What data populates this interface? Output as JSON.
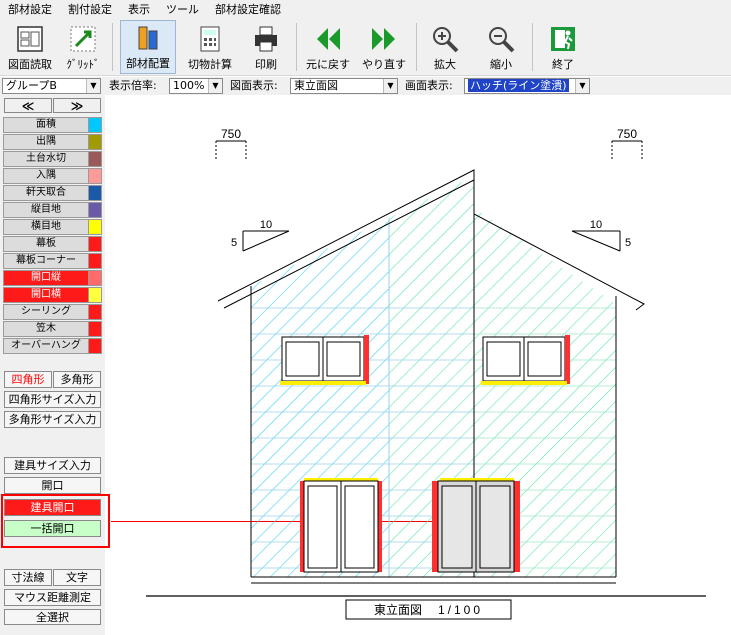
{
  "menu": [
    "部材設定",
    "割付設定",
    "表示",
    "ツール",
    "部材設定確認"
  ],
  "toolbar": {
    "load": "図面読取",
    "grid": "ｸﾞﾘｯﾄﾞ",
    "place": "部材配置",
    "calc": "切物計算",
    "print": "印刷",
    "undo": "元に戻す",
    "redo": "やり直す",
    "zoom_in": "拡大",
    "zoom_out": "縮小",
    "exit": "終了"
  },
  "options": {
    "group": "グループB",
    "scale_label": "表示倍率:",
    "scale": "100%",
    "view_label": "図面表示:",
    "view": "東立面図",
    "screen_label": "画面表示:",
    "screen": "ハッチ(ライン塗潰)"
  },
  "panel": {
    "prev": "≪",
    "next": "≫",
    "layers": [
      {
        "label": "面積",
        "color": "#00c8ff",
        "red": false
      },
      {
        "label": "出隅",
        "color": "#a09b00",
        "red": false
      },
      {
        "label": "土台水切",
        "color": "#9a5a5a",
        "red": false
      },
      {
        "label": "入隅",
        "color": "#ff9a9a",
        "red": false
      },
      {
        "label": "軒天取合",
        "color": "#1a5aa8",
        "red": false
      },
      {
        "label": "縦目地",
        "color": "#6a5aa8",
        "red": false
      },
      {
        "label": "横目地",
        "color": "#ffff00",
        "red": false
      },
      {
        "label": "幕板",
        "color": "#ff1a1a",
        "red": false
      },
      {
        "label": "幕板コーナー",
        "color": "#ff1a1a",
        "red": false
      },
      {
        "label": "開口縦",
        "color": "#ff6a6a",
        "red": true
      },
      {
        "label": "開口横",
        "color": "#ffff40",
        "red": true
      },
      {
        "label": "シーリング",
        "color": "#ff1a1a",
        "red": false
      },
      {
        "label": "笠木",
        "color": "#ff1a1a",
        "red": false
      },
      {
        "label": "オーバーハング",
        "color": "#ff1a1a",
        "red": false
      }
    ],
    "rect": "四角形",
    "poly": "多角形",
    "rect_size": "四角形サイズ入力",
    "poly_size": "多角形サイズ入力",
    "fitting_size": "建具サイズ入力",
    "opening": "開口",
    "fitting_opening": "建具開口",
    "bulk_opening": "一括開口",
    "dim_line": "寸法線",
    "text": "文字",
    "measure": "マウス距離測定",
    "select_all": "全選択"
  },
  "drawing": {
    "dim_left": "750",
    "dim_right": "750",
    "pitch_left_run": "10",
    "pitch_left_rise": "5",
    "pitch_right_run": "10",
    "pitch_right_rise": "5",
    "title": "東立面図",
    "scale": "1/100"
  },
  "colors": {
    "hatch_cyan": "#3fd0f0",
    "hatch_green": "#5ee8a8",
    "frame_red": "#ff3030",
    "frame_yellow": "#ffee00",
    "highlight": "#ff0000"
  }
}
